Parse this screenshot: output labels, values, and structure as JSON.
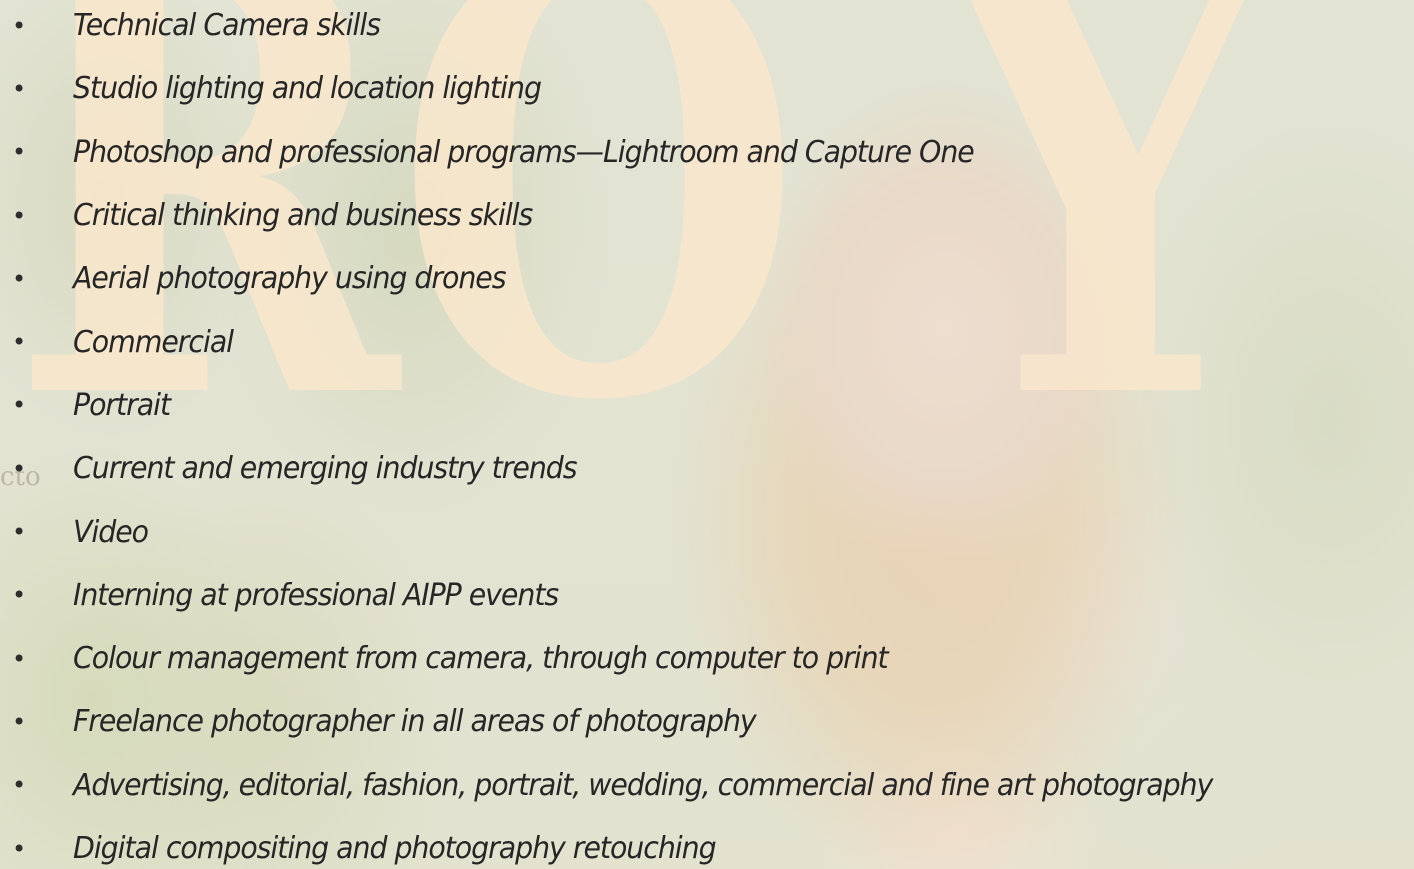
{
  "background": {
    "masthead_letters": [
      "R",
      "O",
      "Y"
    ],
    "masthead_edge_text": "cto",
    "colors": {
      "masthead": "#fae2be",
      "text": "#262626"
    }
  },
  "skills": {
    "bullet_glyph": "•",
    "items": [
      "Technical Camera skills",
      "Studio lighting and location lighting",
      "Photoshop and professional programs—Lightroom and Capture One",
      "Critical thinking and business skills",
      "Aerial photography using drones",
      "Commercial",
      "Portrait",
      "Current and emerging industry trends",
      "Video",
      "Interning at professional AIPP events",
      "Colour management from camera, through computer to print",
      "Freelance photographer in all areas of photography",
      "Advertising, editorial, fashion, portrait, wedding, commercial and fine art photography",
      "Digital compositing and photography retouching"
    ]
  }
}
